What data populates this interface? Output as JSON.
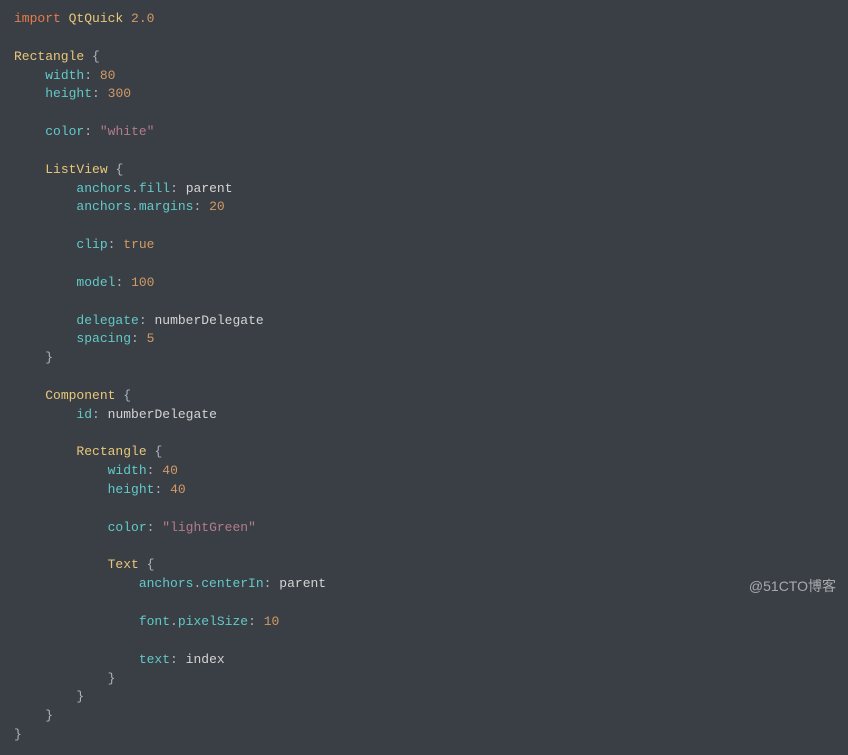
{
  "watermark": "@51CTO博客",
  "code": {
    "l01_import": "import",
    "l01_module": "QtQuick",
    "l01_ver": "2.0",
    "l02_type": "Rectangle",
    "l02_brace": "{",
    "l03_prop": "width",
    "l03_val": "80",
    "l04_prop": "height",
    "l04_val": "300",
    "l05_prop": "color",
    "l05_val": "\"white\"",
    "l06_type": "ListView",
    "l06_brace": "{",
    "l07_prop1": "anchors",
    "l07_prop2": "fill",
    "l07_val": "parent",
    "l08_prop1": "anchors",
    "l08_prop2": "margins",
    "l08_val": "20",
    "l09_prop": "clip",
    "l09_val": "true",
    "l10_prop": "model",
    "l10_val": "100",
    "l11_prop": "delegate",
    "l11_val": "numberDelegate",
    "l12_prop": "spacing",
    "l12_val": "5",
    "l13_brace": "}",
    "l14_type": "Component",
    "l14_brace": "{",
    "l15_prop": "id",
    "l15_val": "numberDelegate",
    "l16_type": "Rectangle",
    "l16_brace": "{",
    "l17_prop": "width",
    "l17_val": "40",
    "l18_prop": "height",
    "l18_val": "40",
    "l19_prop": "color",
    "l19_val": "\"lightGreen\"",
    "l20_type": "Text",
    "l20_brace": "{",
    "l21_prop1": "anchors",
    "l21_prop2": "centerIn",
    "l21_val": "parent",
    "l22_prop1": "font",
    "l22_prop2": "pixelSize",
    "l22_val": "10",
    "l23_prop": "text",
    "l23_val": "index",
    "l24_brace": "}",
    "l25_brace": "}",
    "l26_brace": "}",
    "l27_brace": "}"
  }
}
